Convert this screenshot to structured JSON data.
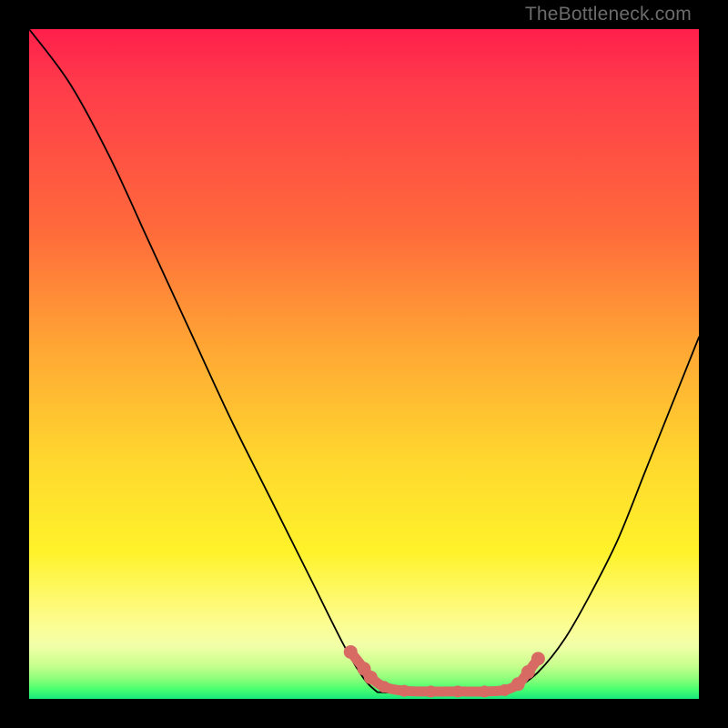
{
  "watermark": "TheBottleneck.com",
  "chart_data": {
    "type": "line",
    "title": "",
    "xlabel": "",
    "ylabel": "",
    "xlim": [
      0,
      100
    ],
    "ylim": [
      0,
      100
    ],
    "grid": false,
    "series": [
      {
        "name": "left-curve",
        "x": [
          0,
          6,
          12,
          18,
          24,
          30,
          36,
          42,
          47,
          50,
          52
        ],
        "y": [
          100,
          92,
          81,
          68,
          55,
          42,
          30,
          18,
          8,
          3,
          1
        ]
      },
      {
        "name": "valley-floor",
        "x": [
          52,
          56,
          60,
          64,
          68,
          72
        ],
        "y": [
          1,
          0.9,
          0.9,
          0.9,
          0.9,
          1
        ]
      },
      {
        "name": "right-curve",
        "x": [
          72,
          76,
          80,
          84,
          88,
          92,
          96,
          100
        ],
        "y": [
          1,
          4,
          9,
          16,
          24,
          34,
          44,
          54
        ]
      }
    ],
    "marker_path": {
      "name": "bottleneck-marker",
      "color": "#d86a64",
      "points": [
        {
          "x": 48,
          "y": 7
        },
        {
          "x": 50,
          "y": 4.5
        },
        {
          "x": 51,
          "y": 3.2
        },
        {
          "x": 53,
          "y": 1.8
        },
        {
          "x": 56,
          "y": 1.2
        },
        {
          "x": 60,
          "y": 1.1
        },
        {
          "x": 64,
          "y": 1.1
        },
        {
          "x": 68,
          "y": 1.1
        },
        {
          "x": 71,
          "y": 1.3
        },
        {
          "x": 73,
          "y": 2.2
        },
        {
          "x": 74.5,
          "y": 4.0
        },
        {
          "x": 76,
          "y": 6.0
        }
      ]
    },
    "background_gradient": {
      "top": "#ff1f4b",
      "mid": "#ffd92e",
      "bottom": "#17e87a"
    }
  }
}
